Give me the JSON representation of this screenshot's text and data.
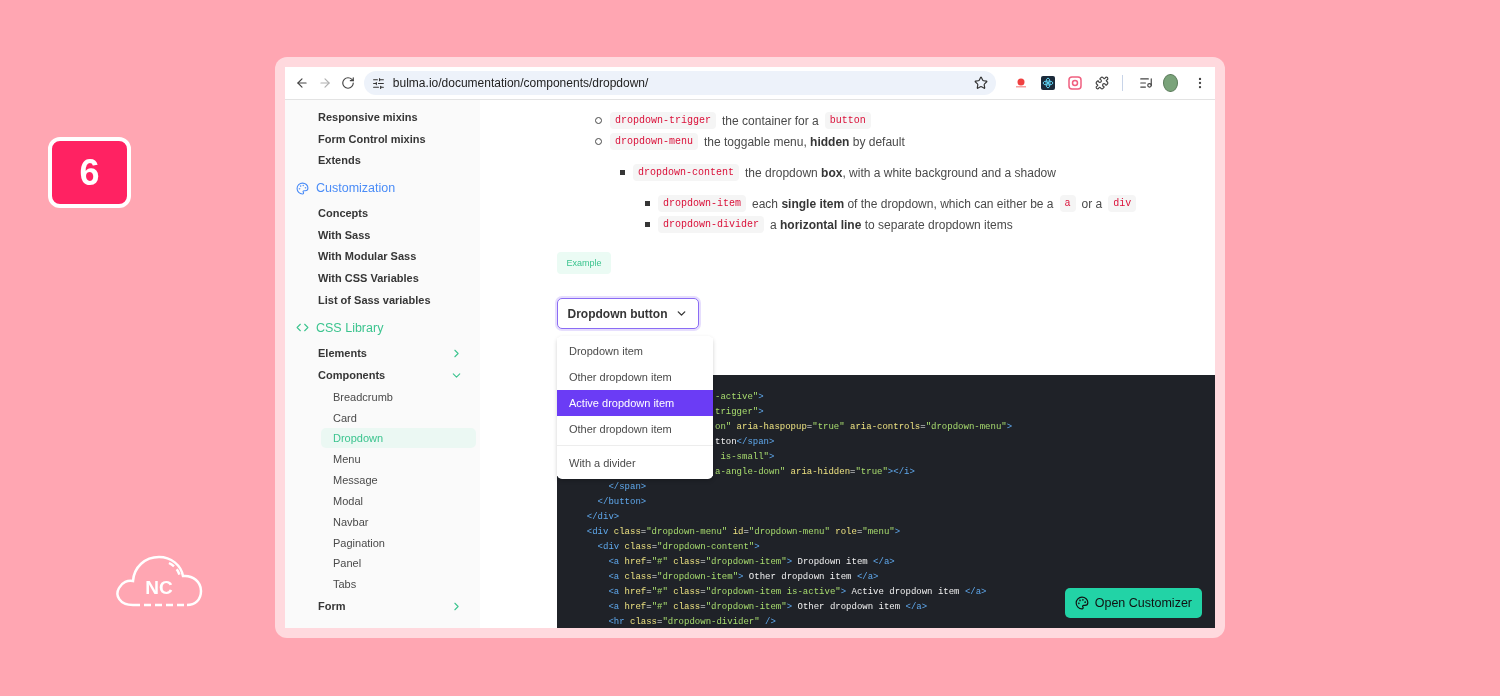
{
  "badge": "6",
  "logo": "NC",
  "browser": {
    "nav": [
      {
        "kind": "back",
        "disabled": false
      },
      {
        "kind": "forward",
        "disabled": true
      },
      {
        "kind": "reload",
        "disabled": false
      }
    ],
    "url": "bulma.io/documentation/components/dropdown/"
  },
  "sidebar": {
    "items": [
      {
        "kind": "link",
        "label": "Responsive mixins"
      },
      {
        "kind": "link",
        "label": "Form Control mixins"
      },
      {
        "kind": "link",
        "label": "Extends"
      },
      {
        "kind": "section",
        "label": "Customization",
        "color": "#4a8cf7",
        "children": [
          {
            "kind": "link",
            "label": "Concepts"
          },
          {
            "kind": "link",
            "label": "With Sass"
          },
          {
            "kind": "link",
            "label": "With Modular Sass"
          },
          {
            "kind": "link",
            "label": "With CSS Variables"
          },
          {
            "kind": "link",
            "label": "List of Sass variables"
          }
        ]
      },
      {
        "kind": "section",
        "label": "CSS Library",
        "color": "#3cc48f",
        "children": [
          {
            "kind": "group",
            "label": "Elements",
            "expanded": false
          },
          {
            "kind": "group",
            "label": "Components",
            "expanded": true,
            "children": [
              {
                "kind": "page",
                "label": "Breadcrumb",
                "selected": false
              },
              {
                "kind": "page",
                "label": "Card",
                "selected": false
              },
              {
                "kind": "page",
                "label": "Dropdown",
                "selected": true
              },
              {
                "kind": "page",
                "label": "Menu",
                "selected": false
              },
              {
                "kind": "page",
                "label": "Message",
                "selected": false
              },
              {
                "kind": "page",
                "label": "Modal",
                "selected": false
              },
              {
                "kind": "page",
                "label": "Navbar",
                "selected": false
              },
              {
                "kind": "page",
                "label": "Pagination",
                "selected": false
              },
              {
                "kind": "page",
                "label": "Panel",
                "selected": false
              },
              {
                "kind": "page",
                "label": "Tabs",
                "selected": false
              }
            ]
          },
          {
            "kind": "group",
            "label": "Form",
            "expanded": false
          }
        ]
      }
    ]
  },
  "bullets": [
    {
      "code": "dropdown-trigger",
      "text": [
        {
          "kind": "text",
          "text": "the container for a"
        },
        {
          "kind": "code",
          "text": "button"
        }
      ]
    },
    {
      "code": "dropdown-menu",
      "text": [
        {
          "kind": "text",
          "text": "the toggable menu, **hidden** by default"
        }
      ],
      "children": [
        {
          "code": "dropdown-content",
          "text": [
            {
              "kind": "text",
              "text": "the dropdown **box**, with a white background and a shadow"
            }
          ],
          "children": [
            {
              "code": "dropdown-item",
              "text": [
                {
                  "kind": "text",
                  "text": "each **single item** of the dropdown, which can either be a"
                },
                {
                  "kind": "code",
                  "text": "a"
                },
                {
                  "kind": "text",
                  "text": "or a"
                },
                {
                  "kind": "code",
                  "text": "div"
                }
              ]
            },
            {
              "code": "dropdown-divider",
              "text": [
                {
                  "kind": "text",
                  "text": "a **horizontal line** to separate dropdown items"
                }
              ]
            }
          ]
        }
      ]
    }
  ],
  "example_tag": "Example",
  "dropdown": {
    "trigger": "Dropdown button",
    "items": [
      {
        "kind": "item",
        "label": "Dropdown item",
        "selected": false
      },
      {
        "kind": "item",
        "label": "Other dropdown item",
        "selected": false
      },
      {
        "kind": "item",
        "label": "Active dropdown item",
        "selected": true
      },
      {
        "kind": "item",
        "label": "Other dropdown item",
        "selected": false
      },
      {
        "kind": "divider"
      },
      {
        "kind": "item",
        "label": "With a divider",
        "selected": false
      }
    ]
  },
  "code_lines": [
    {
      "clipped": true,
      "tokens": [
        {
          "kind": "str",
          "text": "-active\""
        },
        {
          "kind": "tag",
          "text": ">"
        }
      ]
    },
    {
      "clipped": true,
      "tokens": [
        {
          "kind": "str",
          "text": "trigger\""
        },
        {
          "kind": "tag",
          "text": ">"
        }
      ]
    },
    {
      "clipped": true,
      "tokens": [
        {
          "kind": "str",
          "text": "on\""
        },
        {
          "kind": "attr",
          "text": " aria-haspopup"
        },
        {
          "kind": "plain",
          "text": "="
        },
        {
          "kind": "str",
          "text": "\"true\""
        },
        {
          "kind": "attr",
          "text": " aria-controls"
        },
        {
          "kind": "plain",
          "text": "="
        },
        {
          "kind": "str",
          "text": "\"dropdown-menu\""
        },
        {
          "kind": "tag",
          "text": ">"
        }
      ]
    },
    {
      "clipped": true,
      "tokens": [
        {
          "kind": "plain",
          "text": "tton"
        },
        {
          "kind": "tag",
          "text": "</span>"
        }
      ]
    },
    {
      "clipped": true,
      "tokens": [
        {
          "kind": "str",
          "text": " is-small\""
        },
        {
          "kind": "tag",
          "text": ">"
        }
      ]
    },
    {
      "clipped": true,
      "tokens": [
        {
          "kind": "str",
          "text": "a-angle-down\""
        },
        {
          "kind": "attr",
          "text": " aria-hidden"
        },
        {
          "kind": "plain",
          "text": "="
        },
        {
          "kind": "str",
          "text": "\"true\""
        },
        {
          "kind": "tag",
          "text": "></i>"
        }
      ]
    },
    {
      "tokens": [
        {
          "kind": "tag",
          "text": "      </span>"
        }
      ]
    },
    {
      "tokens": [
        {
          "kind": "tag",
          "text": "    </button>"
        }
      ]
    },
    {
      "tokens": [
        {
          "kind": "tag",
          "text": "  </div>"
        }
      ]
    },
    {
      "tokens": [
        {
          "kind": "tag",
          "text": "  <div"
        },
        {
          "kind": "attr",
          "text": " class"
        },
        {
          "kind": "plain",
          "text": "="
        },
        {
          "kind": "str",
          "text": "\"dropdown-menu\""
        },
        {
          "kind": "attr",
          "text": " id"
        },
        {
          "kind": "plain",
          "text": "="
        },
        {
          "kind": "str",
          "text": "\"dropdown-menu\""
        },
        {
          "kind": "attr",
          "text": " role"
        },
        {
          "kind": "plain",
          "text": "="
        },
        {
          "kind": "str",
          "text": "\"menu\""
        },
        {
          "kind": "tag",
          "text": ">"
        }
      ]
    },
    {
      "tokens": [
        {
          "kind": "tag",
          "text": "    <div"
        },
        {
          "kind": "attr",
          "text": " class"
        },
        {
          "kind": "plain",
          "text": "="
        },
        {
          "kind": "str",
          "text": "\"dropdown-content\""
        },
        {
          "kind": "tag",
          "text": ">"
        }
      ]
    },
    {
      "tokens": [
        {
          "kind": "tag",
          "text": "      <a"
        },
        {
          "kind": "attr",
          "text": " href"
        },
        {
          "kind": "plain",
          "text": "="
        },
        {
          "kind": "str",
          "text": "\"#\""
        },
        {
          "kind": "attr",
          "text": " class"
        },
        {
          "kind": "plain",
          "text": "="
        },
        {
          "kind": "str",
          "text": "\"dropdown-item\""
        },
        {
          "kind": "tag",
          "text": ">"
        },
        {
          "kind": "plain",
          "text": " Dropdown item "
        },
        {
          "kind": "tag",
          "text": "</a>"
        }
      ]
    },
    {
      "tokens": [
        {
          "kind": "tag",
          "text": "      <a"
        },
        {
          "kind": "attr",
          "text": " class"
        },
        {
          "kind": "plain",
          "text": "="
        },
        {
          "kind": "str",
          "text": "\"dropdown-item\""
        },
        {
          "kind": "tag",
          "text": ">"
        },
        {
          "kind": "plain",
          "text": " Other dropdown item "
        },
        {
          "kind": "tag",
          "text": "</a>"
        }
      ]
    },
    {
      "tokens": [
        {
          "kind": "tag",
          "text": "      <a"
        },
        {
          "kind": "attr",
          "text": " href"
        },
        {
          "kind": "plain",
          "text": "="
        },
        {
          "kind": "str",
          "text": "\"#\""
        },
        {
          "kind": "attr",
          "text": " class"
        },
        {
          "kind": "plain",
          "text": "="
        },
        {
          "kind": "str",
          "text": "\"dropdown-item is-active\""
        },
        {
          "kind": "tag",
          "text": ">"
        },
        {
          "kind": "plain",
          "text": " Active dropdown item "
        },
        {
          "kind": "tag",
          "text": "</a>"
        }
      ]
    },
    {
      "tokens": [
        {
          "kind": "tag",
          "text": "      <a"
        },
        {
          "kind": "attr",
          "text": " href"
        },
        {
          "kind": "plain",
          "text": "="
        },
        {
          "kind": "str",
          "text": "\"#\""
        },
        {
          "kind": "attr",
          "text": " class"
        },
        {
          "kind": "plain",
          "text": "="
        },
        {
          "kind": "str",
          "text": "\"dropdown-item\""
        },
        {
          "kind": "tag",
          "text": ">"
        },
        {
          "kind": "plain",
          "text": " Other dropdown item "
        },
        {
          "kind": "tag",
          "text": "</a>"
        }
      ]
    },
    {
      "tokens": [
        {
          "kind": "tag",
          "text": "      <hr"
        },
        {
          "kind": "attr",
          "text": " class"
        },
        {
          "kind": "plain",
          "text": "="
        },
        {
          "kind": "str",
          "text": "\"dropdown-divider\""
        },
        {
          "kind": "tag",
          "text": " />"
        }
      ]
    }
  ],
  "customizer_button": "Open Customizer"
}
